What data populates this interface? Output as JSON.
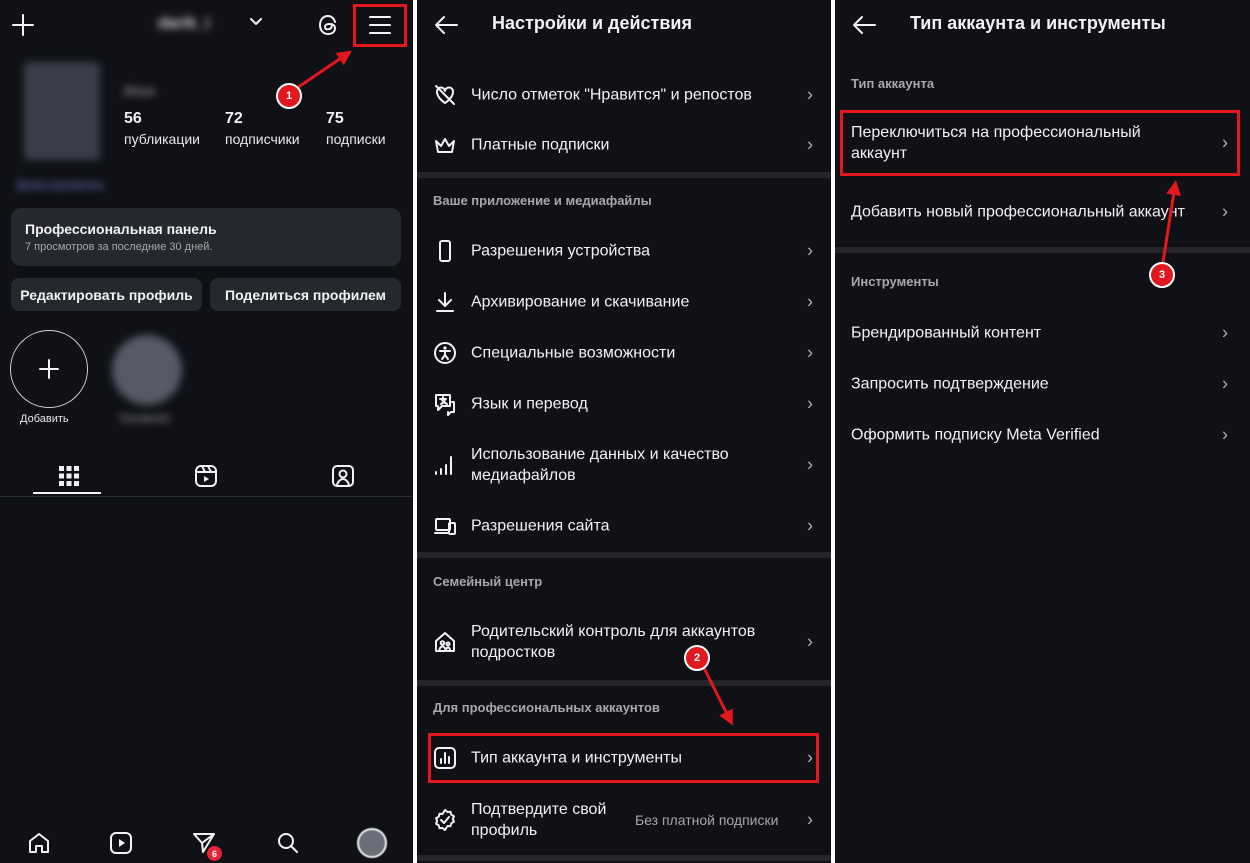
{
  "profile": {
    "username": "darik_i",
    "display_name": "Илья",
    "stats": [
      {
        "value": "56",
        "label": "публикации"
      },
      {
        "value": "72",
        "label": "подписчики"
      },
      {
        "value": "75",
        "label": "подписки"
      }
    ],
    "link": "@ufa.nanotechs",
    "dashboard": {
      "title": "Профессиональная панель",
      "subtitle": "7 просмотров за последние 30 дней."
    },
    "edit_button": "Редактировать профиль",
    "share_button": "Поделиться профилем",
    "highlights": [
      {
        "label": "Добавить",
        "icon": "plus-icon"
      },
      {
        "label": "Yourdemis"
      }
    ],
    "tabs": [
      {
        "icon": "grid-icon"
      },
      {
        "icon": "reels-icon"
      },
      {
        "icon": "tagged-icon"
      }
    ],
    "bottom_nav": [
      {
        "icon": "home-icon"
      },
      {
        "icon": "reels-icon"
      },
      {
        "icon": "direct-icon",
        "badge": "6"
      },
      {
        "icon": "search-icon"
      },
      {
        "icon": "avatar"
      }
    ]
  },
  "settings": {
    "title": "Настройки и действия",
    "items_top": [
      {
        "label": "Число отметок \"Нравится\" и репостов",
        "icon": "heart-crossed-icon"
      },
      {
        "label": "Платные подписки",
        "icon": "crown-icon"
      }
    ],
    "section_app": "Ваше приложение и медиафайлы",
    "items_app": [
      {
        "label": "Разрешения устройства",
        "icon": "phone-icon"
      },
      {
        "label": "Архивирование и скачивание",
        "icon": "download-icon"
      },
      {
        "label": "Специальные возможности",
        "icon": "accessibility-icon"
      },
      {
        "label": "Язык и перевод",
        "icon": "translate-icon"
      },
      {
        "label": "Использование данных и качество медиафайлов",
        "icon": "signal-icon"
      },
      {
        "label": "Разрешения сайта",
        "icon": "devices-icon"
      }
    ],
    "section_family": "Семейный центр",
    "family_item": {
      "label": "Родительский контроль для аккаунтов подростков",
      "icon": "family-home-icon"
    },
    "section_pro": "Для профессиональных аккаунтов",
    "pro_items": [
      {
        "label": "Тип аккаунта и инструменты",
        "icon": "chart-icon"
      },
      {
        "label": "Подтвердите свой профиль",
        "note": "Без платной подписки",
        "icon": "verified-icon"
      }
    ]
  },
  "account_type": {
    "title": "Тип аккаунта и инструменты",
    "section_type": "Тип аккаунта",
    "type_items": [
      "Переключиться на профессиональный аккаунт",
      "Добавить новый профессиональный аккаунт"
    ],
    "section_tools": "Инструменты",
    "tool_items": [
      "Брендированный контент",
      "Запросить подтверждение",
      "Оформить подписку Meta Verified"
    ]
  },
  "annotations": {
    "steps": [
      "1",
      "2",
      "3"
    ],
    "highlight_color": "#e3181f"
  }
}
